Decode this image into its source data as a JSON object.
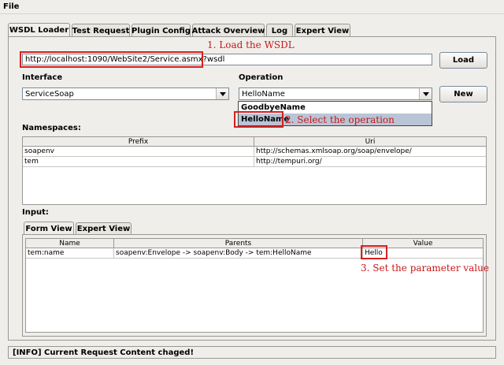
{
  "menu": {
    "file": "File"
  },
  "tabs": [
    "WSDL Loader",
    "Test Request",
    "Plugin Config",
    "Attack Overview",
    "Log",
    "Expert View"
  ],
  "wsdl_url": "http://localhost:1090/WebSite2/Service.asmx?wsdl",
  "load_label": "Load",
  "interface_label": "Interface",
  "interface_value": "ServiceSoap",
  "operation_label": "Operation",
  "operation_value": "HelloName",
  "operation_options": [
    "GoodbyeName",
    "HelloName"
  ],
  "new_label": "New",
  "namespaces_label": "Namespaces:",
  "namespaces_table": {
    "headers": [
      "Prefix",
      "Uri"
    ],
    "rows": [
      [
        "soapenv",
        "http://schemas.xmlsoap.org/soap/envelope/"
      ],
      [
        "tem",
        "http://tempuri.org/"
      ]
    ]
  },
  "input_label": "Input:",
  "input_tabs": [
    "Form View",
    "Expert View"
  ],
  "input_table": {
    "headers": [
      "Name",
      "Parents",
      "Value"
    ],
    "rows": [
      [
        "tem:name",
        "soapenv:Envelope -> soapenv:Body -> tem:HelloName",
        "Hello"
      ]
    ]
  },
  "annotations": {
    "step1": "1. Load the WSDL",
    "step2": "2. Select the operation",
    "step3": "3. Set the parameter value"
  },
  "status": "[INFO] Current Request Content chaged!",
  "colors": {
    "annotation": "#d62020",
    "selection": "#b9c5d6"
  }
}
